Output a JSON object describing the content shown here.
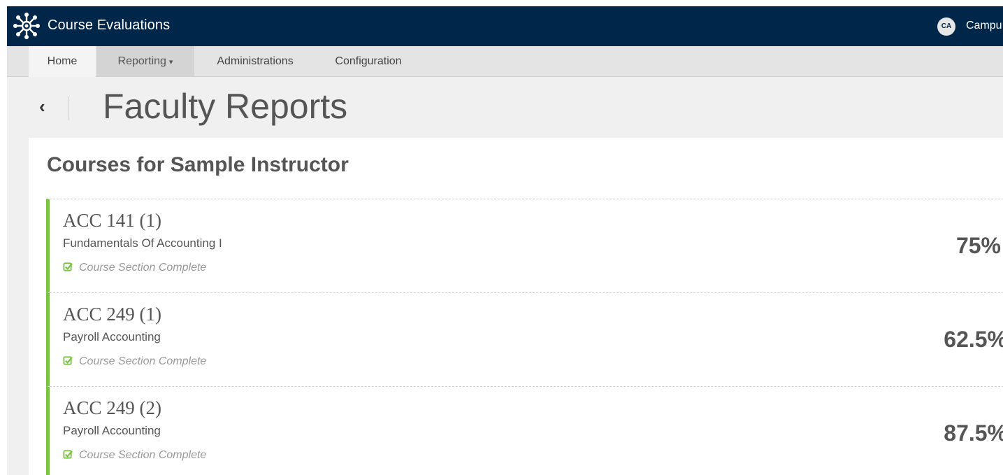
{
  "app": {
    "title": "Course Evaluations"
  },
  "user": {
    "initials": "CA",
    "name": "Campu"
  },
  "nav": {
    "home": "Home",
    "reporting": "Reporting",
    "reporting_caret": "▾",
    "administrations": "Administrations",
    "configuration": "Configuration"
  },
  "page": {
    "back": "‹",
    "title": "Faculty Reports"
  },
  "card": {
    "title": "Courses for Sample Instructor"
  },
  "courses": [
    {
      "code": "ACC 141 (1)",
      "name": "Fundamentals Of Accounting I",
      "status": "Course Section Complete",
      "score": "75%"
    },
    {
      "code": "ACC 249 (1)",
      "name": "Payroll Accounting",
      "status": "Course Section Complete",
      "score": "62.5%"
    },
    {
      "code": "ACC 249 (2)",
      "name": "Payroll Accounting",
      "status": "Course Section Complete",
      "score": "87.5%"
    }
  ],
  "colors": {
    "topbar": "#00264a",
    "accent": "#7cc243"
  }
}
